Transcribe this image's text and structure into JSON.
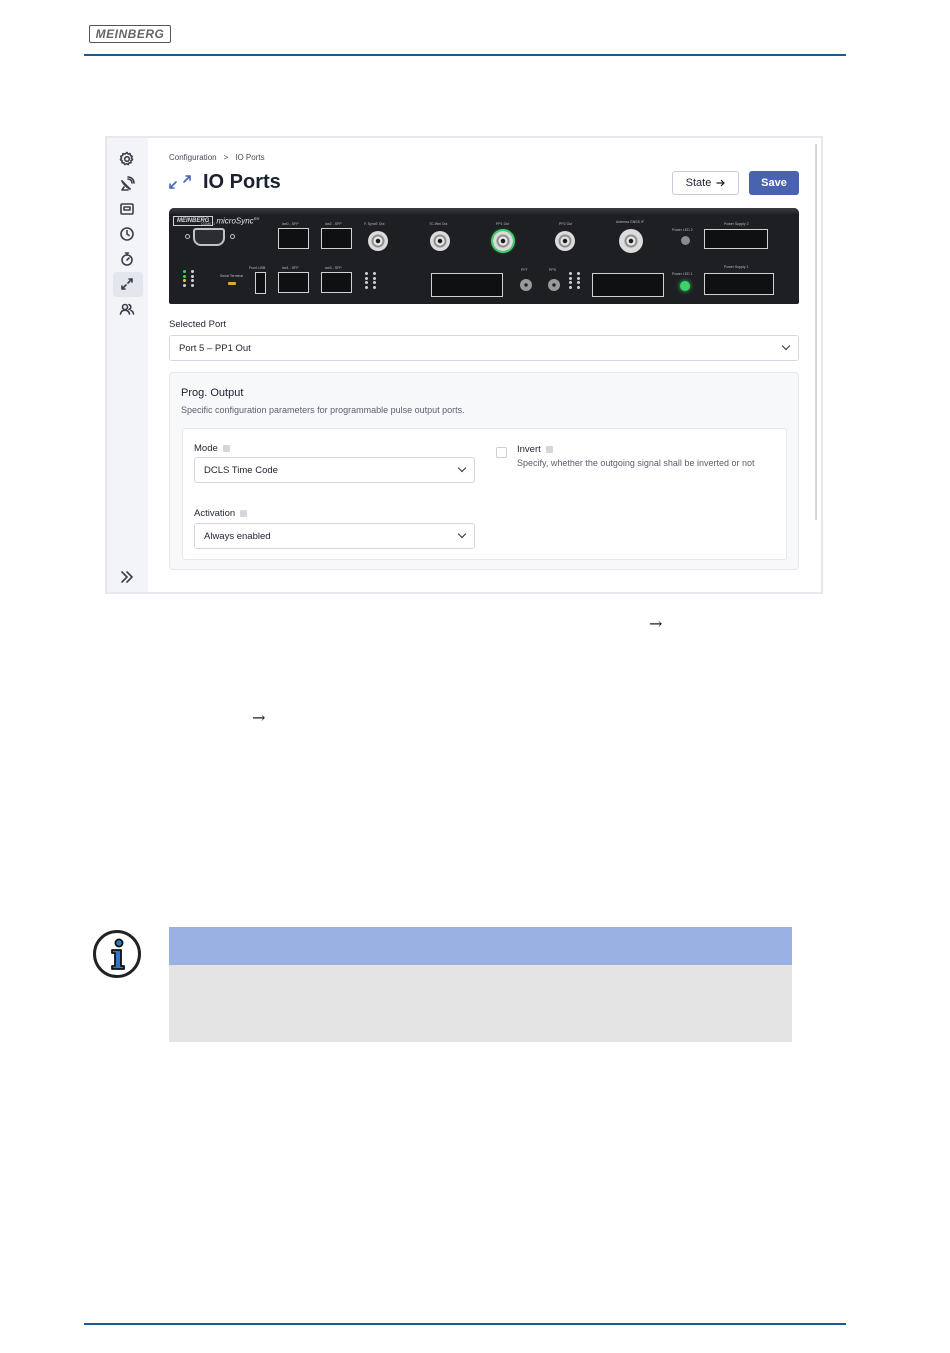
{
  "doc": {
    "logo": "MEINBERG",
    "arrow1": "→",
    "arrow2": "→"
  },
  "app": {
    "sidebar": {
      "items": [
        {
          "icon": "gear-icon"
        },
        {
          "icon": "satellite-icon"
        },
        {
          "icon": "network-card-icon"
        },
        {
          "icon": "clock-icon"
        },
        {
          "icon": "stopwatch-icon"
        },
        {
          "icon": "io-ports-icon",
          "active": true
        },
        {
          "icon": "users-icon"
        }
      ],
      "expand_icon": "double-chevron-right-icon"
    },
    "breadcrumb": {
      "root": "Configuration",
      "separator": ">",
      "current": "IO Ports"
    },
    "page_title": "IO Ports",
    "buttons": {
      "state": "State",
      "save": "Save"
    },
    "device": {
      "brand_box": "MEINBERG",
      "model": "microSync",
      "model_sup": "RX",
      "labels": {
        "com0": "COM0 /1",
        "lan0": "lan0 - SFP",
        "lan2": "lan2 - SFP",
        "lan1": "lan1 - SFP",
        "lan3": "lan3 - SFP",
        "synce": "F. SyncE Out",
        "tc": "TC-Wel Out",
        "pp1": "PP1 Out",
        "pp2": "PP2 Out",
        "antenna": "Antenna GNSS IF",
        "psu2": "Power Supply 2",
        "psu1": "Power Supply 1",
        "power_led2": "Power LED 2",
        "power_led1": "Power LED 1",
        "front_usb": "Front USB",
        "serial_terminal": "Serial Terminal",
        "ppt": "PPT",
        "pps": "PPS"
      }
    },
    "selected_port": {
      "label": "Selected Port",
      "value": "Port 5 – PP1 Out"
    },
    "prog_output": {
      "title": "Prog. Output",
      "subtitle": "Specific configuration parameters for programmable pulse output ports.",
      "mode": {
        "label": "Mode",
        "value": "DCLS Time Code"
      },
      "activation": {
        "label": "Activation",
        "value": "Always enabled"
      },
      "invert": {
        "label": "Invert",
        "checked": false,
        "description": "Specify, whether the outgoing signal shall be inverted or not"
      }
    }
  },
  "colors": {
    "accent": "#4a63b0",
    "rule": "#1d5a8c",
    "info_header": "#99b2e3",
    "info_body": "#e4e4e4",
    "led_green": "#3bd26a"
  }
}
